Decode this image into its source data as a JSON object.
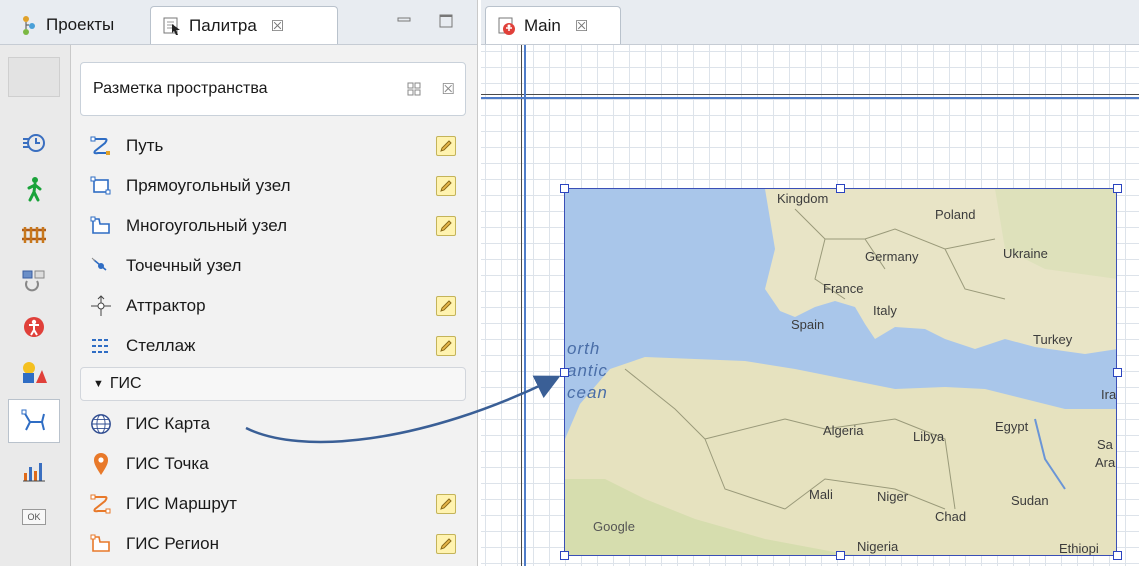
{
  "left_panel": {
    "tabs": [
      {
        "label": "Проекты",
        "icon": "projects-icon"
      },
      {
        "label": "Палитра",
        "icon": "palette-icon",
        "close": "☒"
      }
    ],
    "palette_header": {
      "title": "Разметка пространства",
      "close": "☒"
    },
    "items": [
      {
        "label": "Путь",
        "icon": "path-icon",
        "editable": true
      },
      {
        "label": "Прямоугольный узел",
        "icon": "rectangular-node-icon",
        "editable": true
      },
      {
        "label": "Многоугольный узел",
        "icon": "polygonal-node-icon",
        "editable": true
      },
      {
        "label": "Точечный узел",
        "icon": "point-node-icon",
        "editable": false
      },
      {
        "label": "Аттрактор",
        "icon": "attractor-icon",
        "editable": true
      },
      {
        "label": "Стеллаж",
        "icon": "rack-icon",
        "editable": true
      }
    ],
    "gis_section": {
      "title": "ГИС",
      "collapse_arrow": "▼"
    },
    "gis_items": [
      {
        "label": "ГИС Карта",
        "icon": "globe-icon",
        "editable": false
      },
      {
        "label": "ГИС Точка",
        "icon": "location-pin-icon",
        "editable": false
      },
      {
        "label": "ГИС Маршрут",
        "icon": "gis-route-icon",
        "editable": true
      },
      {
        "label": "ГИС Регион",
        "icon": "gis-region-icon",
        "editable": true
      }
    ],
    "sidebar_icons": [
      "process-icon",
      "pedestrian-icon",
      "rail-icon",
      "fluid-icon",
      "agent-icon",
      "presentation-icon",
      "space-markup-icon",
      "analysis-icon",
      "controls-icon"
    ],
    "sidebar_controls_label": "OK"
  },
  "right_panel": {
    "tab": {
      "label": "Main",
      "icon": "agent-type-icon",
      "close": "☒"
    }
  },
  "map": {
    "labels": {
      "kingdom": "Kingdom",
      "poland": "Poland",
      "germany": "Germany",
      "ukraine": "Ukraine",
      "france": "France",
      "italy": "Italy",
      "spain": "Spain",
      "turkey": "Turkey",
      "iraq": "Iraq",
      "algeria": "Algeria",
      "libya": "Libya",
      "egypt": "Egypt",
      "sa": "Sa",
      "ara": "Ara",
      "mali": "Mali",
      "niger": "Niger",
      "chad": "Chad",
      "sudan": "Sudan",
      "nigeria": "Nigeria",
      "ethiopia": "Ethiopi",
      "google": "Google",
      "orth": "orth",
      "antic": "antic",
      "cean": "cean"
    }
  },
  "colors": {
    "accent": "#2b44c0",
    "grid": "#dde3ea",
    "sea": "#a9c6ea",
    "land": "#e9e4c8"
  }
}
